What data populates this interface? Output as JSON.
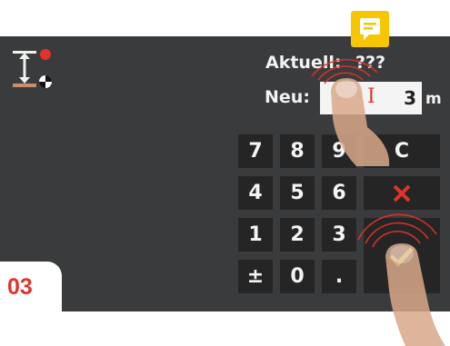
{
  "header": {
    "current_label": "Aktuell:",
    "current_value": "???",
    "new_label": "Neu:"
  },
  "input": {
    "value": "3",
    "unit": "m"
  },
  "keypad": {
    "rows": [
      [
        "7",
        "8",
        "9",
        "C"
      ],
      [
        "4",
        "5",
        "6"
      ],
      [
        "1",
        "2",
        "3"
      ],
      [
        "±",
        "0",
        "."
      ]
    ]
  },
  "badge": {
    "step": "03"
  },
  "colors": {
    "accent_red": "#e0342a",
    "confirm_yellow": "#e8e23a",
    "note_yellow": "#f7c600",
    "key_bg": "#252526",
    "screen_bg": "#3a3b3c"
  },
  "icons": {
    "app": "height-measure-icon",
    "note": "note-icon",
    "cancel": "close-icon",
    "confirm": "check-icon",
    "cursor": "text-cursor-icon"
  }
}
